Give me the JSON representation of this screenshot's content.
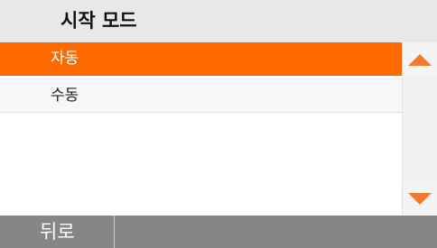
{
  "header": {
    "title": "시작 모드"
  },
  "list": {
    "items": [
      {
        "label": "자동",
        "selected": true
      },
      {
        "label": "수동",
        "selected": false
      }
    ]
  },
  "scrollbar": {
    "up_icon": "triangle-up-icon",
    "down_icon": "triangle-down-icon"
  },
  "footer": {
    "back_label": "뒤로"
  },
  "colors": {
    "accent": "#ff6a00",
    "arrow": "#f27a2a",
    "footer_bg": "#868686",
    "header_bg": "#e8e8e8"
  }
}
